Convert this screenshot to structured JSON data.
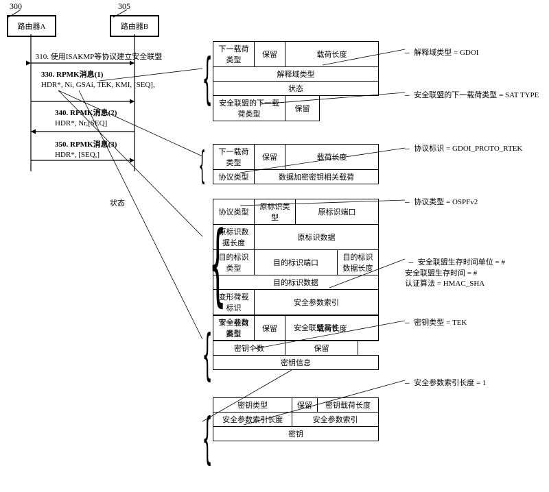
{
  "routerA": {
    "ref": "300",
    "label": "路由器A"
  },
  "routerB": {
    "ref": "305",
    "label": "路由器B"
  },
  "seq": {
    "step310": "310. 使用ISAKMP等协议建立安全联盟",
    "step330": {
      "title": "330. RPMK消息(1)",
      "body": "HDR*, Ni, GSAi, TEK, KMI, [SEQ],"
    },
    "step340": {
      "title": "340. RPMK消息(2)",
      "body": "HDR*, Nr,[SEQ]"
    },
    "step350": {
      "title": "350. RPMK消息(3)",
      "body": "HDR*, [SEQ,]"
    },
    "status": "状态"
  },
  "panel1": {
    "nextPayloadType": "下一载荷类型",
    "reserved": "保留",
    "payloadLength": "载荷长度",
    "doiType": "解释域类型",
    "status": "状态",
    "saNextPayloadType": "安全联盟的下一载荷类型",
    "annoDOI": "解释域类型 = GDOI",
    "annoSAType": "安全联盟的下一载荷类型 = SAT TYPE"
  },
  "panel2": {
    "nextPayloadType": "下一载荷类型",
    "reserved": "保留",
    "payloadLength": "载荷长度",
    "protocolType": "协议类型",
    "dekPayload": "数据加密密钥相关载荷",
    "annoProtoId": "协议标识 = GDOI_PROTO_RTEK"
  },
  "panel3": {
    "protocolType": "协议类型",
    "srcIdType": "原标识类型",
    "srcIdPort": "原标识端口",
    "srcIdDataLen": "原标识数据长度",
    "srcIdData": "原标识数据",
    "dstIdType": "目的标识类型",
    "dstIdPort": "目的标识端口",
    "dstIdDataLen": "目的标识数据长度",
    "dstIdData": "目的标识数据",
    "transPayloadId": "变形荷载标识",
    "spi": "安全参数索引",
    "spiLen": "安全参数索引",
    "saAttr": "安全联盟属性",
    "annoProtoType": "协议类型 = OSPFv2",
    "annoSA": "安全联盟生存时间单位 = #\n安全联盟生存时间 = #\n认证算法 = HMAC_SHA"
  },
  "panel4": {
    "nextPayloadType": "下一载荷类型",
    "reserved": "保留",
    "payloadLength": "载荷长度",
    "keyCount": "密钥个数",
    "keyInfo": "密钥信息",
    "annoKeyType": "密钥类型 = TEK"
  },
  "panel5": {
    "keyType": "密钥类型",
    "reserved": "保留",
    "keyPayloadLen": "密钥载荷长度",
    "spiLen": "安全参数索引长度",
    "spi": "安全参数索引",
    "key": "密钥",
    "annoSpiLen": "安全参数索引长度 = 1"
  }
}
